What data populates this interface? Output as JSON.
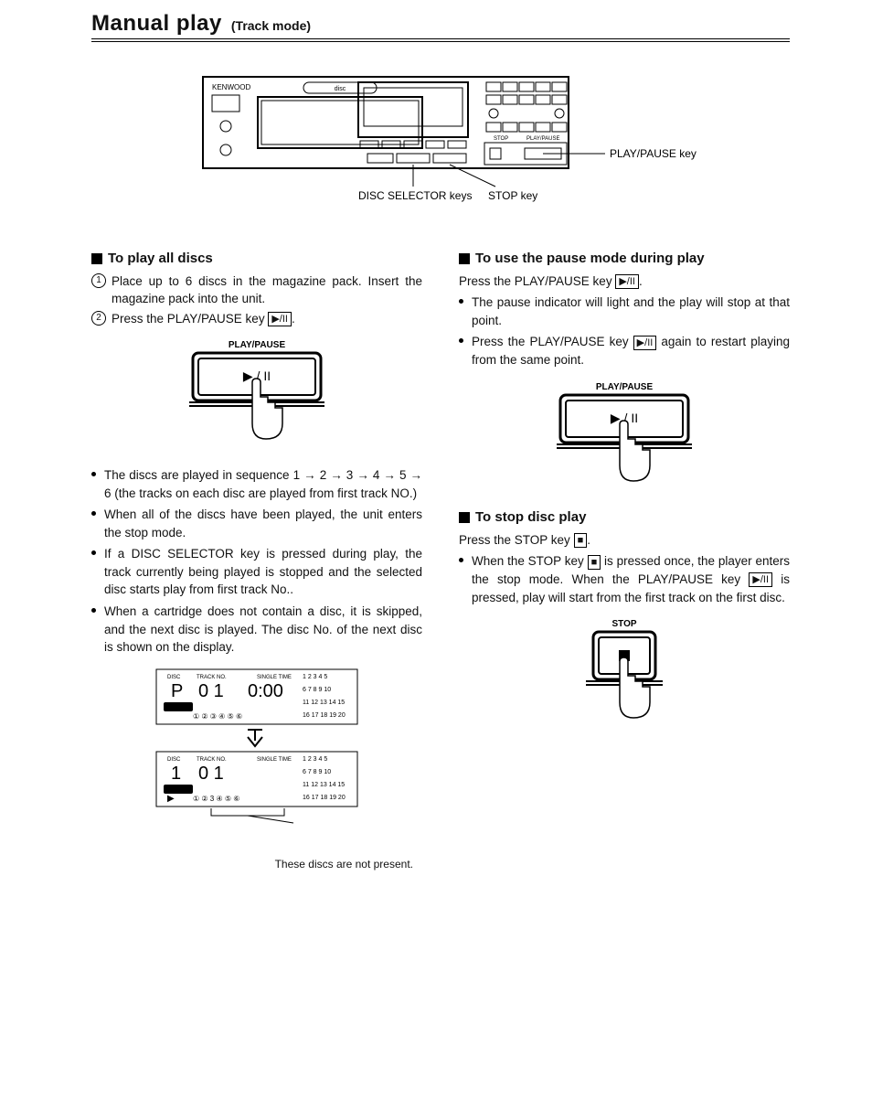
{
  "header": {
    "title": "Manual play",
    "subtitle": "(Track mode)"
  },
  "device": {
    "brand": "KENWOOD",
    "label_disc_selector": "DISC SELECTOR keys",
    "label_stop": "STOP key",
    "label_playpause": "PLAY/PAUSE key"
  },
  "left": {
    "sec1_head": "To play all discs",
    "step1": "Place up to 6 discs in the magazine pack. Insert the magazine pack into the unit.",
    "step2_a": "Press the PLAY/PAUSE key ",
    "step2_key": "▶/II",
    "step2_b": ".",
    "illus_label": "PLAY/PAUSE",
    "illus_symbol": "▶/II",
    "b1": "The discs are played in sequence 1 → 2 → 3 → 4 → 5 → 6 (the tracks on each disc are played from first track NO.)",
    "b2": "When all of the discs have been played, the unit enters the stop mode.",
    "b3": "If a DISC SELECTOR key is pressed during play, the track currently being played is stopped and the selected disc starts play from first track No..",
    "b4": "When a cartridge does not contain a disc, it is skipped, and the next disc is played. The disc No. of the next disc is shown on the display.",
    "display": {
      "labels": {
        "disc": "DISC",
        "track": "TRACK",
        "no": "NO.",
        "single": "SINGLE",
        "time": "TIME"
      },
      "row1": {
        "disc": "P",
        "track": "0 1",
        "time": "0:00"
      },
      "row2": {
        "disc": "1",
        "track": "0 1",
        "time": ""
      },
      "grid": [
        "1",
        "2",
        "3",
        "4",
        "5",
        "6",
        "7",
        "8",
        "9",
        "10",
        "11",
        "12",
        "13",
        "14",
        "15",
        "16",
        "17",
        "18",
        "19",
        "20"
      ],
      "caption": "These discs are not present."
    }
  },
  "right": {
    "sec1_head": "To use the pause mode during play",
    "press_a": "Press the PLAY/PAUSE key ",
    "press_key": "▶/II",
    "press_b": ".",
    "b1": "The pause indicator will light and the play will stop at that point.",
    "b2_a": "Press the PLAY/PAUSE key ",
    "b2_key": "▶/II",
    "b2_b": " again to restart playing from the same point.",
    "illus_label": "PLAY/PAUSE",
    "illus_symbol": "▶/II",
    "sec2_head": "To stop disc play",
    "press2_a": "Press the STOP key ",
    "press2_key": "■",
    "press2_b": ".",
    "b3_a": "When the STOP key ",
    "b3_key1": "■",
    "b3_b": " is pressed once, the player enters the stop mode. When the PLAY/PAUSE key ",
    "b3_key2": "▶/II",
    "b3_c": " is pressed, play will start from the first track on the first disc.",
    "illus2_label": "STOP",
    "illus2_symbol": "■"
  }
}
